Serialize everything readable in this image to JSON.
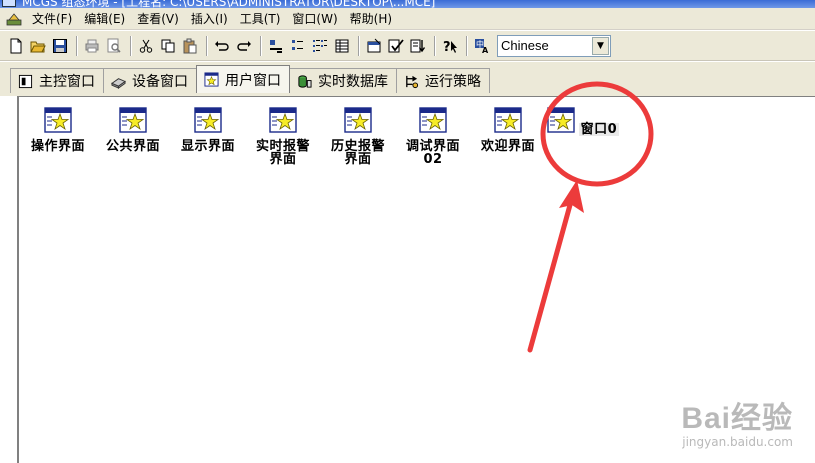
{
  "window": {
    "title": "MCGS 组态环境 - [工程名: C:\\USERS\\ADMINISTRATOR\\DESKTOP\\...MCE]"
  },
  "menu": {
    "items": [
      {
        "label": "文件(F)"
      },
      {
        "label": "编辑(E)"
      },
      {
        "label": "查看(V)"
      },
      {
        "label": "插入(I)"
      },
      {
        "label": "工具(T)"
      },
      {
        "label": "窗口(W)"
      },
      {
        "label": "帮助(H)"
      }
    ]
  },
  "toolbar": {
    "language": "Chinese"
  },
  "tabs": [
    {
      "label": "主控窗口",
      "icon": "main-window-icon"
    },
    {
      "label": "设备窗口",
      "icon": "device-icon"
    },
    {
      "label": "用户窗口",
      "icon": "user-window-icon",
      "active": true
    },
    {
      "label": "实时数据库",
      "icon": "database-icon"
    },
    {
      "label": "运行策略",
      "icon": "strategy-icon"
    }
  ],
  "user_windows": [
    {
      "line1": "操作界面",
      "line2": ""
    },
    {
      "line1": "公共界面",
      "line2": ""
    },
    {
      "line1": "显示界面",
      "line2": ""
    },
    {
      "line1": "实时报警",
      "line2": "界面"
    },
    {
      "line1": "历史报警",
      "line2": "界面"
    },
    {
      "line1": "调试界面",
      "line2": "02"
    },
    {
      "line1": "欢迎界面",
      "line2": ""
    },
    {
      "line1": "窗口0",
      "line2": ""
    }
  ],
  "colors": {
    "annotation": "#ec3b3b",
    "chrome": "#ece9d8"
  },
  "watermark": {
    "logo": "Bai经验",
    "url": "jingyan.baidu.com"
  }
}
